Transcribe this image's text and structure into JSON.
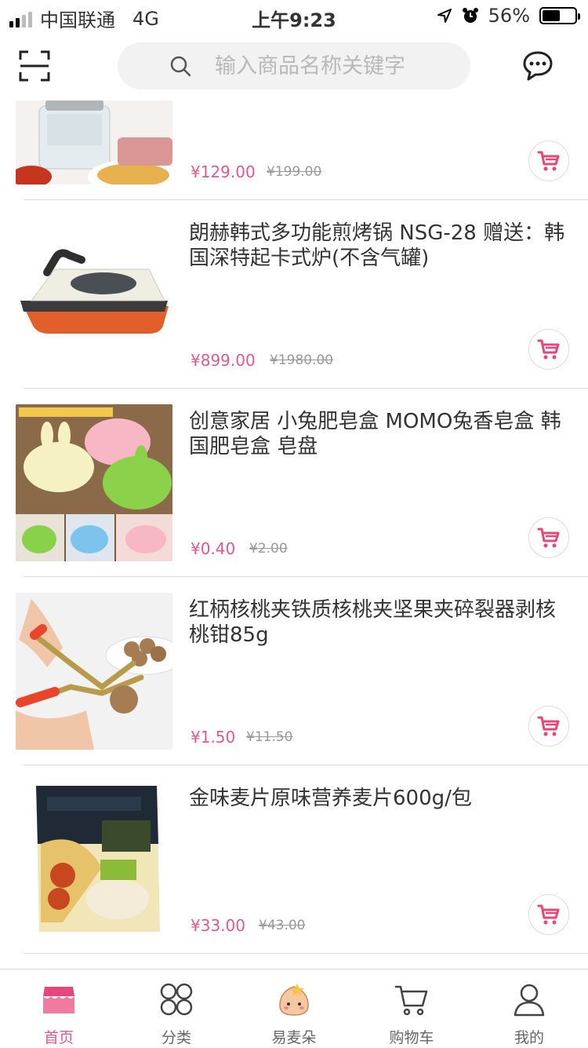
{
  "status_bar": {
    "carrier": "中国联通",
    "network": "4G",
    "time": "上午9:23",
    "battery": "56%",
    "battery_level": 0.56
  },
  "header": {
    "scan_icon": "scan-icon",
    "search_placeholder": "输入商品名称关键字",
    "message_icon": "message-icon"
  },
  "products": [
    {
      "title": "",
      "price": "¥129.00",
      "old_price": "¥199.00",
      "image": "meat-grinder-image"
    },
    {
      "title": "朗赫韩式多功能煎烤锅 NSG-28 赠送：韩国深特起卡式炉(不含气罐)",
      "price": "¥899.00",
      "old_price": "¥1980.00",
      "image": "grill-pan-image"
    },
    {
      "title": "创意家居 小兔肥皂盒 MOMO兔香皂盒 韩国肥皂盒 皂盘",
      "price": "¥0.40",
      "old_price": "¥2.00",
      "image": "soap-box-image"
    },
    {
      "title": "红柄核桃夹铁质核桃夹坚果夹碎裂器剥核桃钳85g",
      "price": "¥1.50",
      "old_price": "¥11.50",
      "image": "walnut-cracker-image"
    },
    {
      "title": "金味麦片原味营养麦片600g/包",
      "price": "¥33.00",
      "old_price": "¥43.00",
      "image": "oatmeal-package-image"
    }
  ],
  "tabbar": [
    {
      "label": "首页",
      "icon": "home-shop-icon",
      "active": true
    },
    {
      "label": "分类",
      "icon": "category-icon",
      "active": false
    },
    {
      "label": "易麦朵",
      "icon": "mascot-icon",
      "active": false
    },
    {
      "label": "购物车",
      "icon": "cart-icon",
      "active": false
    },
    {
      "label": "我的",
      "icon": "user-icon",
      "active": false
    }
  ],
  "colors": {
    "accent": "#e05a8a",
    "cart_icon": "#e8457a",
    "divider": "#dddddd"
  }
}
